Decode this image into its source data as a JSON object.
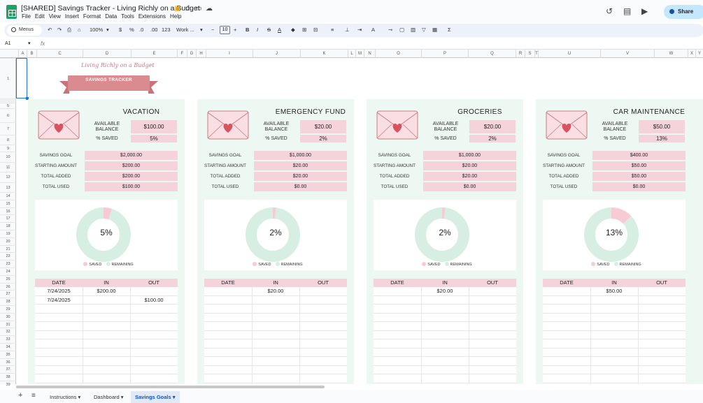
{
  "app": {
    "title": "[SHARED] Savings Tracker - Living Richly on a Budget",
    "menu": [
      "File",
      "Edit",
      "View",
      "Insert",
      "Format",
      "Data",
      "Tools",
      "Extensions",
      "Help"
    ],
    "share_label": "Share"
  },
  "toolbar": {
    "search_label": "Menus",
    "zoom": "100%",
    "currency": "$",
    "percent": "%",
    "dec_decrease": ".0",
    "dec_increase": ".00",
    "number_format": "123",
    "font": "Work ...",
    "font_size": "10",
    "bold": "B",
    "italic": "I",
    "strike": "S",
    "text_color": "A",
    "sum": "Σ"
  },
  "formula": {
    "cell": "A1",
    "fx": "fx"
  },
  "columns": [
    "A",
    "B",
    "C",
    "D",
    "E",
    "F",
    "G",
    "H",
    "I",
    "J",
    "K",
    "L",
    "M",
    "N",
    "O",
    "P",
    "Q",
    "R",
    "S",
    "T",
    "U",
    "V",
    "W",
    "X",
    "Y"
  ],
  "rows": [
    "1",
    "2",
    "3",
    "4",
    "5",
    "6",
    "7",
    "8",
    "9",
    "10",
    "11",
    "12",
    "13",
    "14",
    "15",
    "16",
    "17",
    "18",
    "19",
    "20",
    "21",
    "22",
    "23",
    "24",
    "25",
    "26",
    "27",
    "28",
    "29",
    "30",
    "31",
    "32",
    "33",
    "34",
    "35",
    "36",
    "37",
    "38",
    "39"
  ],
  "brand": {
    "script": "Living Richly on a Budget",
    "ribbon": "SAVINGS TRACKER"
  },
  "labels": {
    "available": "AVAILABLE",
    "balance": "BALANCE",
    "pct_saved": "% SAVED",
    "savings_goal": "SAVINGS GOAL",
    "starting_amount": "STARTING AMOUNT",
    "total_added": "TOTAL ADDED",
    "total_used": "TOTAL USED",
    "legend_saved": "SAVED",
    "legend_remaining": "REMAINING",
    "col_date": "DATE",
    "col_in": "IN",
    "col_out": "OUT"
  },
  "colors": {
    "card_bg": "#eef8f3",
    "pink": "#f5d3da",
    "saved": "#f7cbd3",
    "remaining": "#d6efe2",
    "ribbon": "#d98b8f"
  },
  "cards": [
    {
      "title": "VACATION",
      "available_balance": "$100.00",
      "pct_saved": "5%",
      "savings_goal": "$2,000.00",
      "starting_amount": "$200.00",
      "total_added": "$200.00",
      "total_used": "$100.00",
      "donut_pct": "5%",
      "saved_fraction": 0.05,
      "rows": [
        {
          "date": "7/24/2025",
          "in": "$200.00",
          "out": ""
        },
        {
          "date": "7/24/2025",
          "in": "",
          "out": "$100.00"
        }
      ]
    },
    {
      "title": "EMERGENCY FUND",
      "available_balance": "$20.00",
      "pct_saved": "2%",
      "savings_goal": "$1,000.00",
      "starting_amount": "$20.00",
      "total_added": "$20.00",
      "total_used": "$0.00",
      "donut_pct": "2%",
      "saved_fraction": 0.02,
      "rows": [
        {
          "date": "",
          "in": "$20.00",
          "out": ""
        }
      ]
    },
    {
      "title": "GROCERIES",
      "available_balance": "$20.00",
      "pct_saved": "2%",
      "savings_goal": "$1,000.00",
      "starting_amount": "$20.00",
      "total_added": "$20.00",
      "total_used": "$0.00",
      "donut_pct": "2%",
      "saved_fraction": 0.02,
      "rows": [
        {
          "date": "",
          "in": "$20.00",
          "out": ""
        }
      ]
    },
    {
      "title": "CAR MAINTENANCE",
      "available_balance": "$50.00",
      "pct_saved": "13%",
      "savings_goal": "$400.00",
      "starting_amount": "$50.00",
      "total_added": "$50.00",
      "total_used": "$0.00",
      "donut_pct": "13%",
      "saved_fraction": 0.13,
      "rows": [
        {
          "date": "",
          "in": "$50.00",
          "out": ""
        }
      ]
    }
  ],
  "sheets": [
    {
      "name": "Instructions",
      "active": false
    },
    {
      "name": "Dashboard",
      "active": false
    },
    {
      "name": "Savings Goals",
      "active": true
    }
  ]
}
